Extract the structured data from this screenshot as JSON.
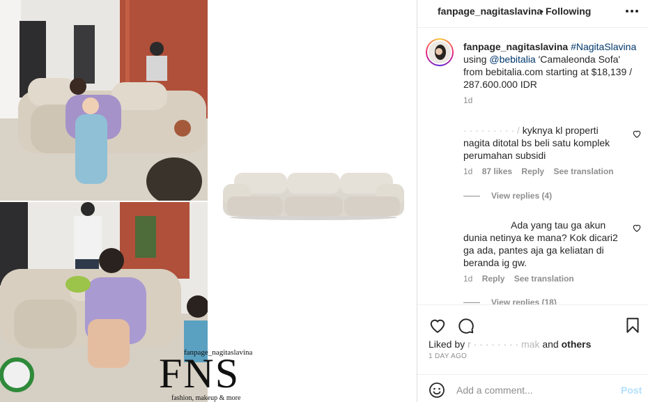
{
  "header": {
    "username": "fanpage_nagitaslavina",
    "separator": "•",
    "follow_state": "Following",
    "more_icon": "more-horizontal-icon"
  },
  "watermark": {
    "handle": "fanpage_nagitaslavina",
    "logo": "FNS",
    "tagline": "fashion, makeup & more"
  },
  "caption": {
    "username": "fanpage_nagitaslavina",
    "hashtag": "#NagitaSlavina",
    "text_1": "using",
    "mention": "@bebitalia",
    "text_2": "'Camaleonda Sofa' from bebitalia.com starting at $18,139 / 287.600.000 IDR",
    "time": "1d"
  },
  "comments": [
    {
      "username_hidden": "· · · · · · · · · /",
      "text": "kyknya kl properti nagita ditotal bs beli satu komplek perumahan subsidi",
      "time": "1d",
      "likes": "87 likes",
      "reply": "Reply",
      "translate": "See translation",
      "view_replies": "View replies (4)"
    },
    {
      "username_hidden": "",
      "text": "Ada yang tau ga akun dunia netinya ke mana? Kok dicari2 ga ada, pantes aja ga keliatan di beranda ig gw.",
      "time": "1d",
      "reply": "Reply",
      "translate": "See translation",
      "view_replies": "View replies (18)"
    }
  ],
  "actions": {
    "liked_prefix": "Liked by",
    "liked_user_hidden": "r · · · · · · · · mak",
    "liked_and": "and",
    "liked_others": "others",
    "post_time": "1 DAY AGO"
  },
  "add_comment": {
    "placeholder": "Add a comment...",
    "post_label": "Post"
  },
  "colors": {
    "link": "#00376b",
    "muted": "#8e8e8e",
    "post_disabled": "#b2dffc",
    "text": "#262626"
  }
}
